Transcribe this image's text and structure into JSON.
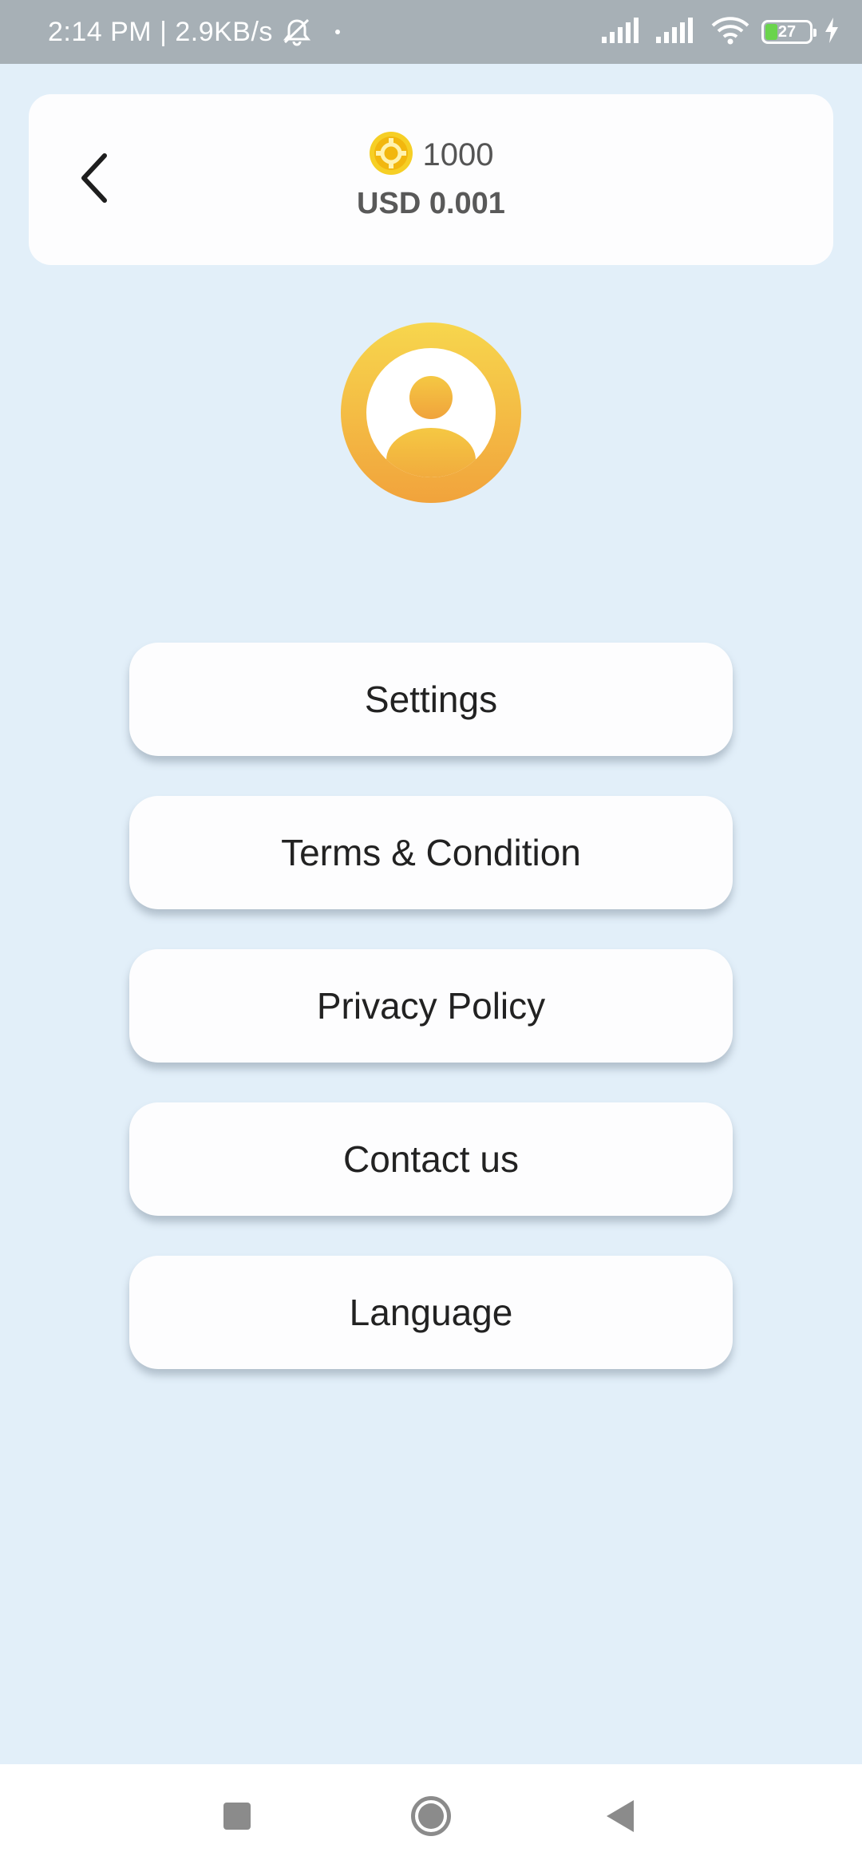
{
  "status_bar": {
    "time_speed": "2:14 PM | 2.9KB/s",
    "battery_percent": "27",
    "battery_level": 0.27,
    "battery_fill_color": "#6ad44c",
    "icons": [
      "bell-off-icon",
      "signal-icon",
      "signal-icon",
      "wifi-icon",
      "battery-icon",
      "charging-icon"
    ]
  },
  "header": {
    "back_icon": "chevron-left-icon",
    "coin_icon": "coin-icon",
    "coin_count": "1000",
    "usd_value": "USD 0.001"
  },
  "profile": {
    "avatar_icon": "user-avatar-icon"
  },
  "menu": {
    "items": [
      {
        "label": "Settings"
      },
      {
        "label": "Terms & Condition"
      },
      {
        "label": "Privacy Policy"
      },
      {
        "label": "Contact us"
      },
      {
        "label": "Language"
      }
    ]
  },
  "nav_bar": {
    "icons": [
      "recents-square-icon",
      "home-circle-icon",
      "back-triangle-icon"
    ]
  },
  "colors": {
    "background": "#e2eff9",
    "card": "#fdfdfe",
    "avatar_gradient_top": "#f7d64d",
    "avatar_gradient_bottom": "#f1a33c",
    "status_bar": "#a7b0b6"
  }
}
